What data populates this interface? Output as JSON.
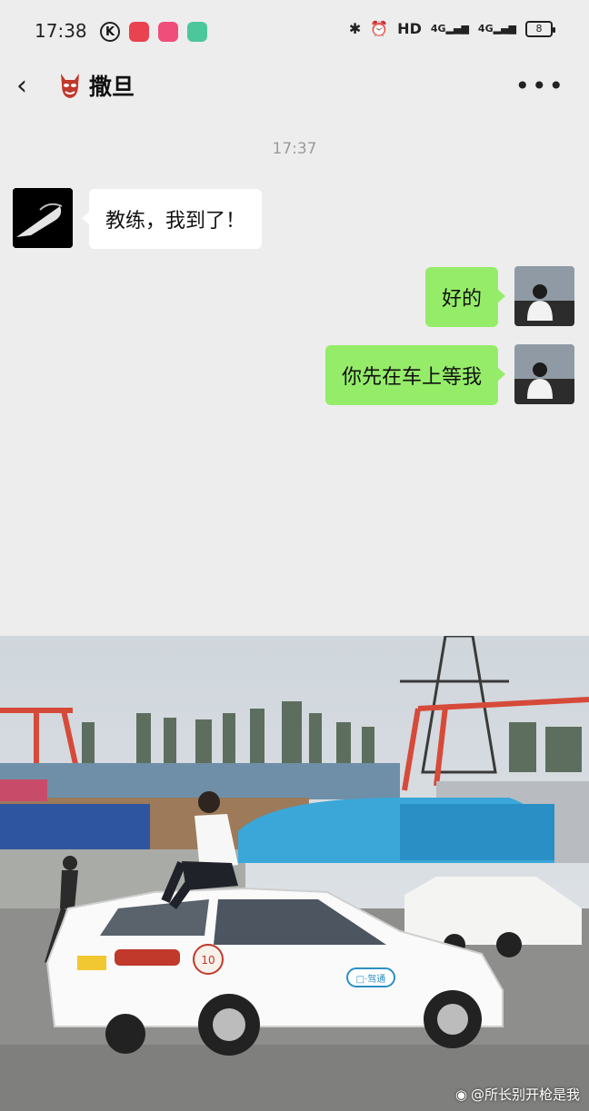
{
  "status_bar": {
    "time": "17:38",
    "hd_label": "HD",
    "signal1": "4G",
    "signal2": "4G",
    "battery": "8"
  },
  "header": {
    "back_icon": "chevron-left",
    "contact_name": "撒旦",
    "contact_emoji_icon": "devil-mask-icon",
    "more_icon": "more-dots"
  },
  "chat": {
    "timestamp": "17:37",
    "messages": [
      {
        "side": "in",
        "text": "教练，我到了！"
      },
      {
        "side": "out",
        "text": "好的"
      },
      {
        "side": "out",
        "text": "你先在车上等我"
      }
    ]
  },
  "photo": {
    "car_number": "10",
    "door_sign": "□·驾通"
  },
  "watermark": {
    "text": "@所长别开枪是我"
  },
  "colors": {
    "background": "#ededed",
    "outgoing_bubble": "#95ec69",
    "incoming_bubble": "#ffffff"
  }
}
